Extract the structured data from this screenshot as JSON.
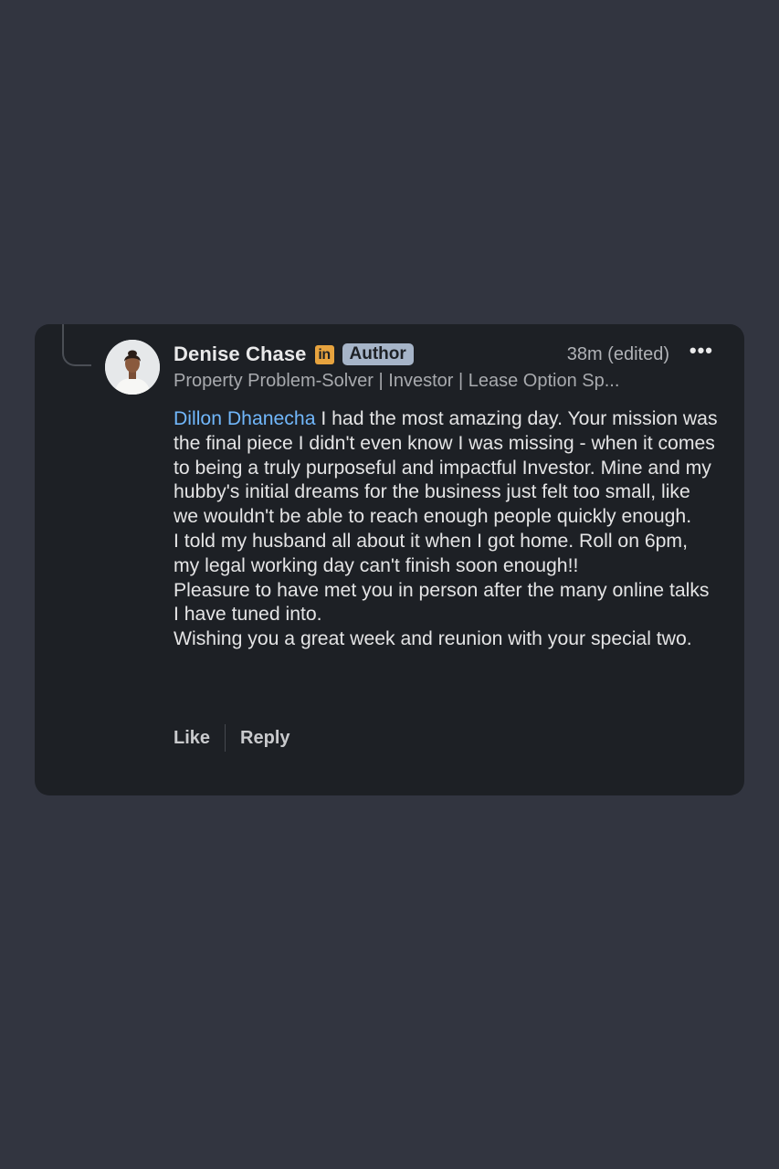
{
  "comment": {
    "author_name": "Denise Chase",
    "linkedin_badge": "in",
    "author_badge": "Author",
    "timestamp": "38m (edited)",
    "more_label": "•••",
    "headline": "Property Problem-Solver | Investor | Lease Option Sp...",
    "mention": "Dillon Dhanecha",
    "paragraphs": [
      " I had the most amazing day. Your mission was the final piece I didn't even know I was missing - when it comes to being a truly purposeful and impactful Investor. Mine and my hubby's initial dreams for the business just felt too small, like we wouldn't be able to reach enough people quickly enough.",
      "I told my husband all about it when I got home. Roll on 6pm, my legal working day can't finish soon enough!!",
      "Pleasure to have met you in person after the many online talks I have tuned into.",
      "Wishing you a great week and reunion with your special two."
    ],
    "actions": {
      "like_label": "Like",
      "reply_label": "Reply"
    }
  },
  "colors": {
    "page_background": "#323540",
    "card_background": "#1d2025",
    "mention": "#71b7fb",
    "linkedin_badge": "#e7a33e",
    "author_badge": "#a6b4c8"
  },
  "icons": {
    "avatar": "profile-photo",
    "linkedin": "linkedin-logo-icon",
    "more": "more-options-icon",
    "thread": "thread-connector-line"
  }
}
